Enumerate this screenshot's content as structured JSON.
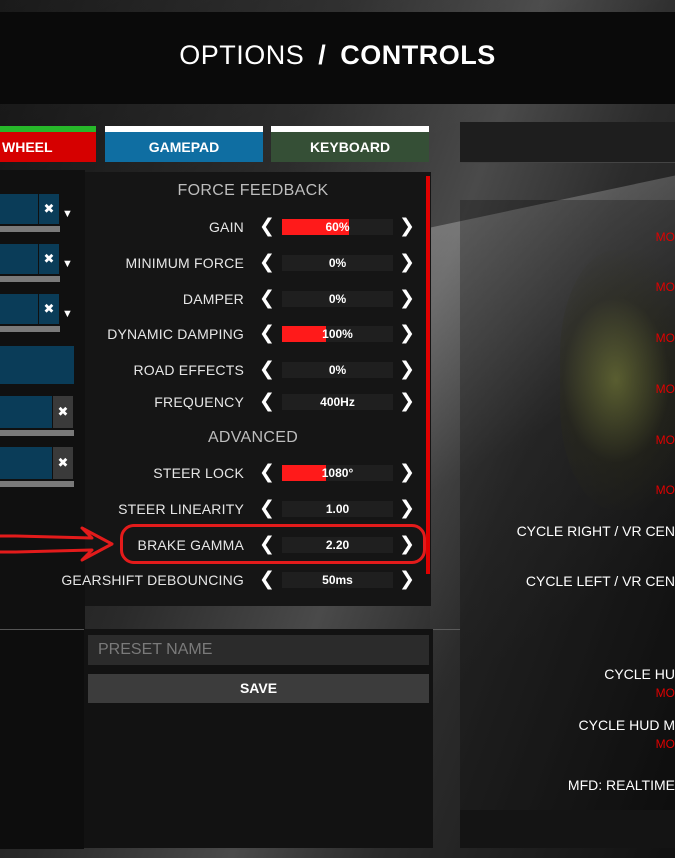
{
  "header": {
    "options_label": "OPTIONS",
    "separator": "/",
    "controls_label": "CONTROLS"
  },
  "tabs": [
    {
      "label": "WHEEL",
      "color": "#d60000",
      "indicator": "#27b82a"
    },
    {
      "label": "GAMEPAD",
      "color": "#0f6ea2",
      "indicator": "#ffffff"
    },
    {
      "label": "KEYBOARD",
      "color": "#354f36",
      "indicator": "#ffffff"
    }
  ],
  "bindings": {
    "clear_glyph": "✖",
    "dropdown_glyph": "▼"
  },
  "ffb": {
    "section_title": "FORCE FEEDBACK",
    "items": [
      {
        "label": "GAIN",
        "value": "60%",
        "fill": 0.6
      },
      {
        "label": "MINIMUM FORCE",
        "value": "0%",
        "fill": 0
      },
      {
        "label": "DAMPER",
        "value": "0%",
        "fill": 0
      },
      {
        "label": "DYNAMIC DAMPING",
        "value": "100%",
        "fill": 0.4
      },
      {
        "label": "ROAD EFFECTS",
        "value": "0%",
        "fill": 0
      },
      {
        "label": "FREQUENCY",
        "value": "400Hz",
        "fill": 0
      }
    ]
  },
  "advanced": {
    "section_title": "ADVANCED",
    "items": [
      {
        "label": "STEER LOCK",
        "value": "1080°",
        "fill": 0.4
      },
      {
        "label": "STEER LINEARITY",
        "value": "1.00",
        "fill": 0
      },
      {
        "label": "BRAKE GAMMA",
        "value": "2.20",
        "fill": 0
      },
      {
        "label": "GEARSHIFT DEBOUNCING",
        "value": "50ms",
        "fill": 0
      }
    ]
  },
  "arrows": {
    "prev": "❮",
    "next": "❯"
  },
  "preset": {
    "placeholder": "PRESET NAME",
    "save_label": "SAVE"
  },
  "right_panel": {
    "labels": [
      "CYCLE RIGHT / VR CEN",
      "CYCLE LEFT / VR CEN",
      "CYCLE HU",
      "CYCLE HUD M",
      "MFD: REALTIME"
    ],
    "values": [
      "MO",
      "MO",
      "MO",
      "MO",
      "MO",
      "MO",
      "MO",
      "MO"
    ]
  },
  "colors": {
    "accent": "#e00000",
    "fill": "#ff1a1a",
    "annotation": "#e31b1b"
  }
}
